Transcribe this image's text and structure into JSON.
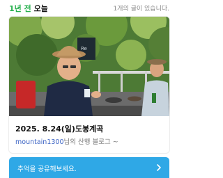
{
  "header": {
    "title_accent": "1년 전",
    "title_rest": " 오늘",
    "count_text": "1개의 글이 있습니다."
  },
  "card": {
    "photo_sign_text": "Re",
    "title": "2025. 8.24(일)도봉계곡",
    "author": "mountain1300",
    "author_suffix": "님의 산행 블로그 ~"
  },
  "share": {
    "label": "추억을 공유해보세요."
  },
  "colors": {
    "accent_green": "#27b04e",
    "share_bar": "#2fa8e6",
    "author_link": "#3b63c4"
  },
  "icons": {
    "share_chevron": "chevron-right-icon"
  }
}
